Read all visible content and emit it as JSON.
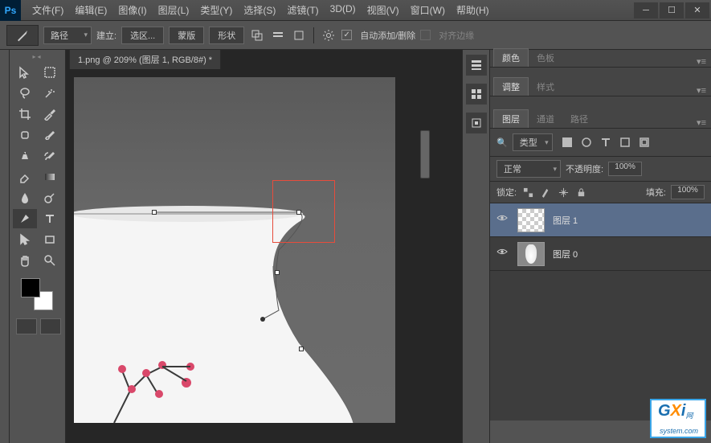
{
  "app": {
    "logo": "Ps"
  },
  "menu": {
    "file": "文件(F)",
    "edit": "编辑(E)",
    "image": "图像(I)",
    "layer": "图层(L)",
    "type": "类型(Y)",
    "select": "选择(S)",
    "filter": "滤镜(T)",
    "threed": "3D(D)",
    "view": "视图(V)",
    "window": "窗口(W)",
    "help": "帮助(H)"
  },
  "options": {
    "mode": "路径",
    "create_label": "建立:",
    "selection": "选区...",
    "mask": "蒙版",
    "shape": "形状",
    "auto_add_label": "自动添加/删除",
    "align_edges_label": "对齐边缘"
  },
  "document": {
    "tab_title": "1.png @ 209% (图层 1, RGB/8#) *"
  },
  "panels": {
    "color": {
      "tab_color": "颜色",
      "tab_swatches": "色板"
    },
    "adjust": {
      "tab_adjust": "调整",
      "tab_styles": "样式"
    },
    "layers": {
      "tab_layers": "图层",
      "tab_channels": "通道",
      "tab_paths": "路径",
      "filter_type": "类型",
      "blend_mode": "正常",
      "opacity_label": "不透明度:",
      "opacity_value": "100%",
      "lock_label": "锁定:",
      "fill_label": "填充:",
      "fill_value": "100%",
      "layer1_name": "图层 1",
      "layer0_name": "图层 0"
    }
  },
  "watermark": {
    "g": "G",
    "x": "X",
    "i": "i",
    "tail": "system.com",
    "url": "网"
  }
}
